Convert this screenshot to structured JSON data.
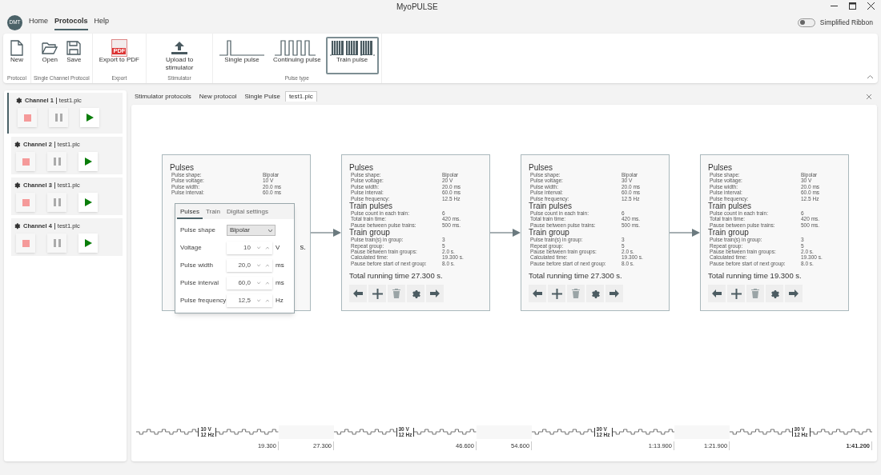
{
  "window": {
    "title": "MyoPULSE"
  },
  "menu": [
    {
      "label": "Home",
      "selected": false
    },
    {
      "label": "Protocols",
      "selected": true
    },
    {
      "label": "Help",
      "selected": false
    }
  ],
  "avatar": "DMT",
  "simplified_ribbon": {
    "label": "Simplified Ribbon",
    "on": false
  },
  "ribbon_groups": [
    {
      "label": "Protocol",
      "buttons": [
        {
          "kind": "new",
          "label": "New"
        }
      ]
    },
    {
      "label": "Single Channel Protocol",
      "buttons": [
        {
          "kind": "open",
          "label": "Open"
        },
        {
          "kind": "save",
          "label": "Save"
        }
      ]
    },
    {
      "label": "Export",
      "buttons": [
        {
          "kind": "pdf",
          "label": "Export to PDF",
          "icon_text": "PDF"
        }
      ]
    },
    {
      "label": "Stimulator",
      "buttons": [
        {
          "kind": "upload",
          "label": "Upload to stimulator"
        }
      ]
    },
    {
      "label": "Pulse type",
      "buttons": [
        {
          "kind": "single",
          "label": "Single pulse",
          "selected": false
        },
        {
          "kind": "continuing",
          "label": "Continuing pulse",
          "selected": false
        },
        {
          "kind": "train",
          "label": "Train pulse",
          "selected": true
        }
      ]
    }
  ],
  "channels": [
    {
      "name": "Channel 1",
      "file": "test1.plc",
      "selected": true
    },
    {
      "name": "Channel 2",
      "file": "test1.plc",
      "selected": false
    },
    {
      "name": "Channel 3",
      "file": "test1.plc",
      "selected": false
    },
    {
      "name": "Channel 4",
      "file": "test1.plc",
      "selected": false
    }
  ],
  "tabs": [
    {
      "label": "Stimulator protocols",
      "selected": false
    },
    {
      "label": "New protocol",
      "selected": false
    },
    {
      "label": "Single Pulse",
      "selected": false
    },
    {
      "label": "test1.plc",
      "selected": true
    }
  ],
  "blocks": [
    {
      "sections": [
        {
          "title": "Pulses",
          "rows": [
            [
              "Pulse shape:",
              "Bipolar"
            ],
            [
              "Pulse voltage:",
              "10 V"
            ],
            [
              "Pulse width:",
              "20.0 ms"
            ],
            [
              "Pulse interval:",
              "60.0 ms"
            ]
          ]
        }
      ],
      "total": "s.",
      "kind": "partial"
    },
    {
      "sections": [
        {
          "title": "Pulses",
          "rows": [
            [
              "Pulse shape:",
              "Bipolar"
            ],
            [
              "Pulse voltage:",
              "20 V"
            ],
            [
              "Pulse width:",
              "20.0 ms"
            ],
            [
              "Pulse interval:",
              "60.0 ms"
            ],
            [
              "Pulse frequency:",
              "12.5 Hz"
            ]
          ]
        },
        {
          "title": "Train pulses",
          "rows": [
            [
              "Pulse count in each train:",
              "6"
            ],
            [
              "Total train time:",
              "420 ms."
            ],
            [
              "Pause between pulse trains:",
              "500 ms."
            ]
          ]
        },
        {
          "title": "Train group",
          "rows": [
            [
              "Pulse train(s) in group:",
              "3"
            ],
            [
              "Repeat group:",
              "5"
            ],
            [
              "Pause between train groups:",
              "2.0 s."
            ],
            [
              "Calculated time:",
              "19.300 s."
            ],
            [
              "Pause before start of next group:",
              "8.0 s."
            ]
          ]
        }
      ],
      "total": "Total running time 27.300 s.",
      "kind": "full"
    },
    {
      "sections": [
        {
          "title": "Pulses",
          "rows": [
            [
              "Pulse shape:",
              "Bipolar"
            ],
            [
              "Pulse voltage:",
              "30 V"
            ],
            [
              "Pulse width:",
              "20.0 ms"
            ],
            [
              "Pulse interval:",
              "60.0 ms"
            ],
            [
              "Pulse frequency:",
              "12.5 Hz"
            ]
          ]
        },
        {
          "title": "Train pulses",
          "rows": [
            [
              "Pulse count in each train:",
              "6"
            ],
            [
              "Total train time:",
              "420 ms."
            ],
            [
              "Pause between pulse trains:",
              "500 ms."
            ]
          ]
        },
        {
          "title": "Train group",
          "rows": [
            [
              "Pulse train(s) in group:",
              "3"
            ],
            [
              "Repeat group:",
              "5"
            ],
            [
              "Pause between train groups:",
              "2.0 s."
            ],
            [
              "Calculated time:",
              "19.300 s."
            ],
            [
              "Pause before start of next group:",
              "8.0 s."
            ]
          ]
        }
      ],
      "total": "Total running time 27.300 s.",
      "kind": "full"
    },
    {
      "sections": [
        {
          "title": "Pulses",
          "rows": [
            [
              "Pulse shape:",
              "Bipolar"
            ],
            [
              "Pulse voltage:",
              "30 V"
            ],
            [
              "Pulse width:",
              "20.0 ms"
            ],
            [
              "Pulse interval:",
              "60.0 ms"
            ],
            [
              "Pulse frequency:",
              "12.5 Hz"
            ]
          ]
        },
        {
          "title": "Train pulses",
          "rows": [
            [
              "Pulse count in each train:",
              "6"
            ],
            [
              "Total train time:",
              "420 ms."
            ],
            [
              "Pause between pulse trains:",
              "500 ms."
            ]
          ]
        },
        {
          "title": "Train group",
          "rows": [
            [
              "Pulse train(s) in group:",
              "3"
            ],
            [
              "Repeat group:",
              "5"
            ],
            [
              "Pause between train groups:",
              "2.0 s."
            ],
            [
              "Calculated time:",
              "19.300 s."
            ],
            [
              "Pause before start of next group:",
              "8.0 s."
            ]
          ]
        }
      ],
      "total": "Total running time 19.300 s.",
      "kind": "full"
    }
  ],
  "settings_popup": {
    "tabs": [
      {
        "label": "Pulses",
        "selected": true
      },
      {
        "label": "Train",
        "selected": false
      },
      {
        "label": "Digital settings",
        "selected": false
      }
    ],
    "fields": [
      {
        "kind": "select",
        "label": "Pulse shape",
        "value": "Bipolar"
      },
      {
        "kind": "number",
        "label": "Voltage",
        "value": "10",
        "unit": "V"
      },
      {
        "kind": "number",
        "label": "Pulse width",
        "value": "20,0",
        "unit": "ms"
      },
      {
        "kind": "number",
        "label": "Pulse interval",
        "value": "60,0",
        "unit": "ms"
      },
      {
        "kind": "number",
        "label": "Pulse frequency",
        "value": "12,5",
        "unit": "Hz"
      }
    ]
  },
  "timeline": [
    {
      "voltage": "10 V",
      "frequency": "12 Hz",
      "end_time": "19.300",
      "pause_end": "27.300",
      "bold": false
    },
    {
      "voltage": "30 V",
      "frequency": "12 Hz",
      "end_time": "46.600",
      "pause_end": "54.600",
      "bold": false
    },
    {
      "voltage": "30 V",
      "frequency": "12 Hz",
      "end_time": "1:13.900",
      "pause_end": "1:21.900",
      "bold": false
    },
    {
      "voltage": "30 V",
      "frequency": "12 Hz",
      "end_time": "1:41.200",
      "bold": true
    }
  ]
}
